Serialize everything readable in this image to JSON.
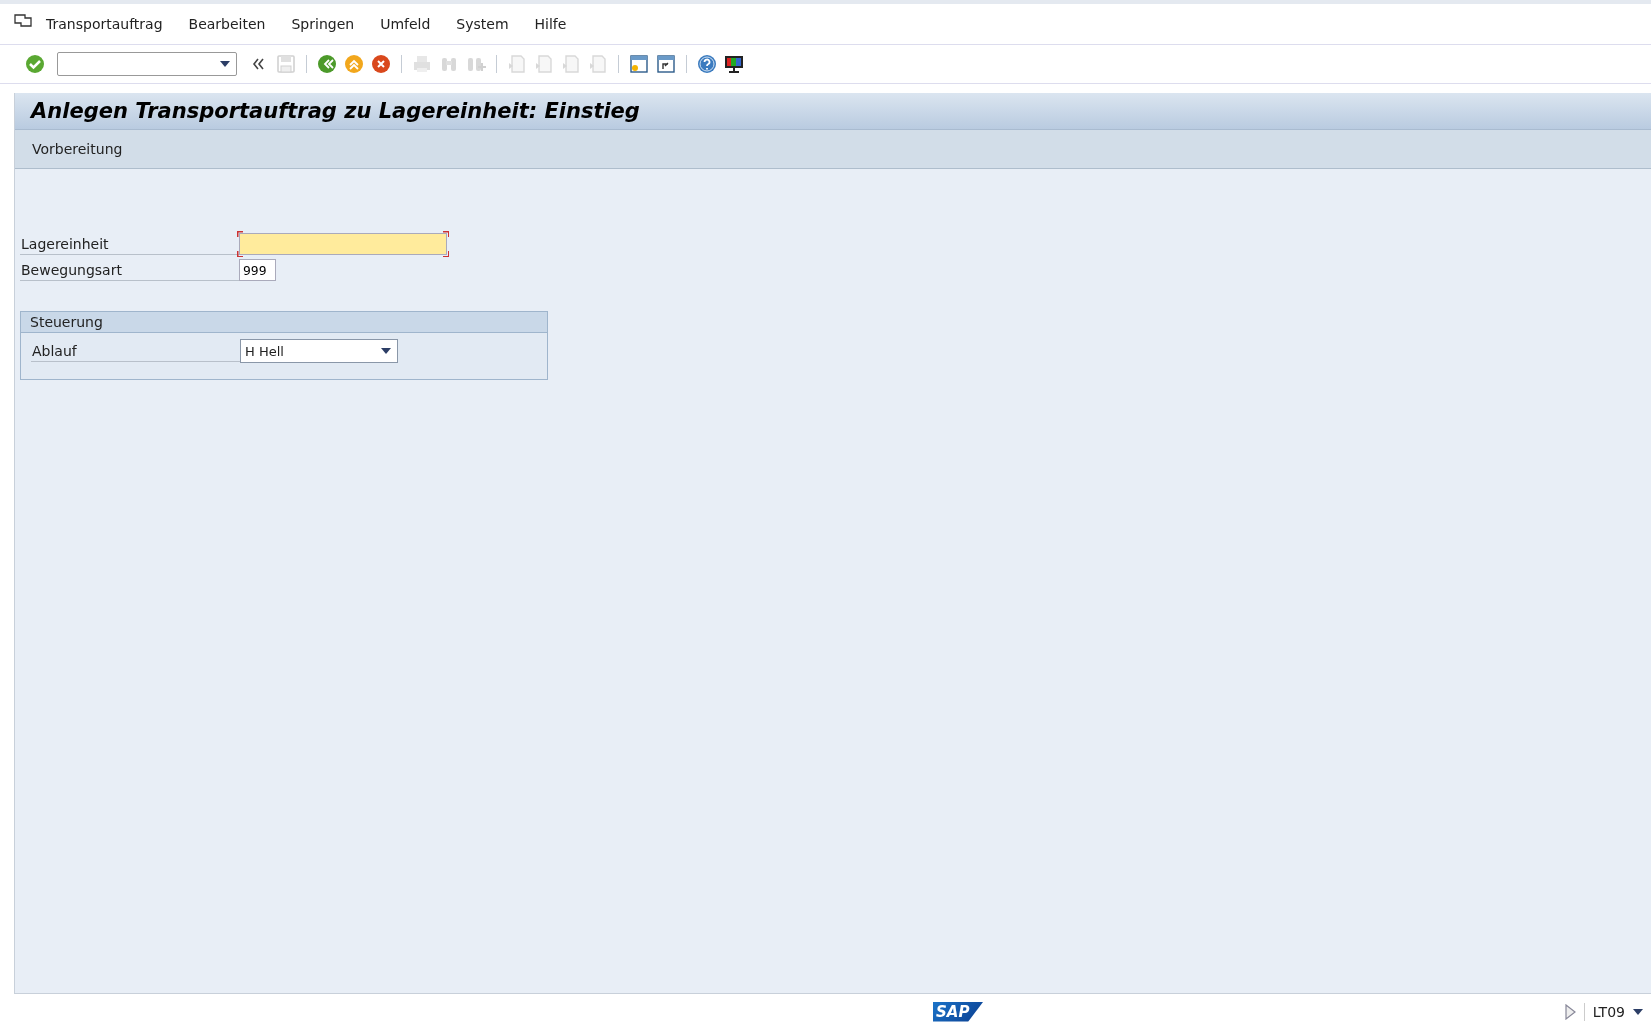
{
  "menu": [
    "Transportauftrag",
    "Bearbeiten",
    "Springen",
    "Umfeld",
    "System",
    "Hilfe"
  ],
  "toolbar": {
    "groups": [
      [
        {
          "kind": "enter",
          "disabled": false
        },
        {
          "kind": "collapse",
          "disabled": false
        },
        {
          "kind": "save",
          "disabled": true
        }
      ],
      [
        {
          "kind": "back",
          "disabled": false
        },
        {
          "kind": "exit",
          "disabled": false
        },
        {
          "kind": "cancel",
          "disabled": false
        }
      ],
      [
        {
          "kind": "print",
          "disabled": true
        },
        {
          "kind": "find",
          "disabled": true
        },
        {
          "kind": "findnext",
          "disabled": true
        }
      ],
      [
        {
          "kind": "page",
          "disabled": true
        },
        {
          "kind": "page",
          "disabled": true
        },
        {
          "kind": "page",
          "disabled": true
        },
        {
          "kind": "page",
          "disabled": true
        }
      ],
      [
        {
          "kind": "newsession",
          "disabled": false
        },
        {
          "kind": "shortcut",
          "disabled": false
        }
      ],
      [
        {
          "kind": "help",
          "disabled": false
        },
        {
          "kind": "layout",
          "disabled": false
        }
      ]
    ]
  },
  "title": "Anlegen Transportauftrag zu Lagereinheit: Einstieg",
  "app_toolbar": [
    "Vorbereitung"
  ],
  "fields": [
    {
      "label": "Lagereinheit",
      "required": true
    },
    {
      "label": "Bewegungsart",
      "value": "999",
      "required": false
    }
  ],
  "group": {
    "title": "Steuerung",
    "fields": [
      {
        "label": "Ablauf",
        "value": "H Hell"
      }
    ]
  },
  "status_bar": {
    "logo": "SAP",
    "transaction": "LT09"
  }
}
